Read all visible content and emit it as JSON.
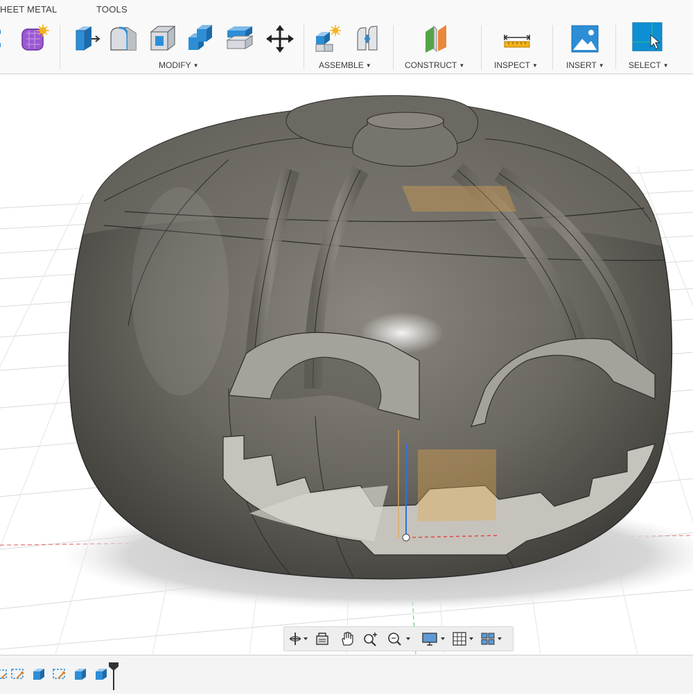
{
  "tabs": {
    "sheet_metal": "HEET METAL",
    "tools": "TOOLS"
  },
  "groups": {
    "modify": "MODIFY",
    "assemble": "ASSEMBLE",
    "construct": "CONSTRUCT",
    "inspect": "INSPECT",
    "insert": "INSERT",
    "select": "SELECT"
  },
  "colors": {
    "accent_blue": "#2d8ed6",
    "select_blue": "#0f8fd3",
    "construct_green": "#53a447",
    "construct_orange": "#e9883b"
  },
  "tools": [
    "form-icon",
    "press-pull-icon",
    "fillet-icon",
    "shell-icon",
    "combine-icon",
    "replace-face-icon",
    "move-icon",
    "new-component-icon",
    "joint-icon",
    "offset-plane-icon",
    "measure-icon",
    "insert-image-icon",
    "select-icon"
  ],
  "navbar_icons": [
    "orbit-icon",
    "look-at-icon",
    "pan-icon",
    "zoom-icon",
    "fit-icon",
    "display-settings-icon",
    "grid-icon",
    "viewports-icon"
  ],
  "timeline_icons": [
    "sketch-icon",
    "extrude-icon",
    "sketch-icon",
    "extrude-icon",
    "extrude-icon",
    "extrude-icon",
    "timeline-marker-icon"
  ]
}
